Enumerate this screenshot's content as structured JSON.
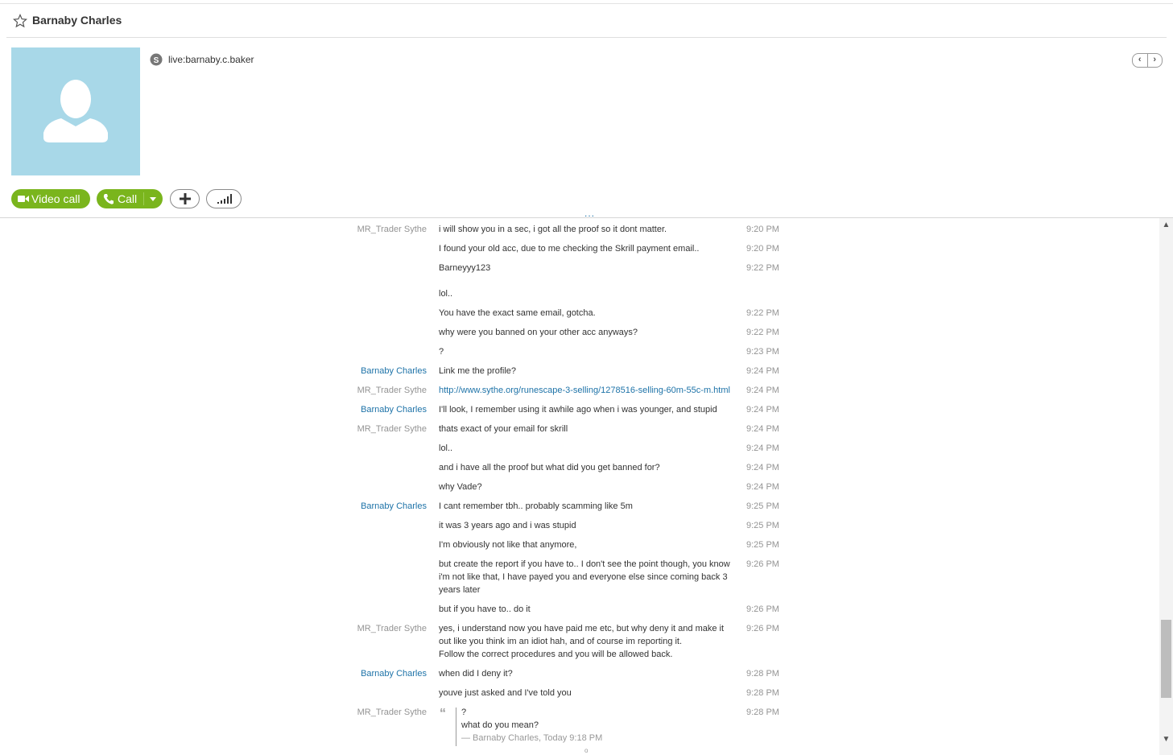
{
  "header": {
    "title": "Barnaby Charles"
  },
  "profile": {
    "account": "live:barnaby.c.baker"
  },
  "nav": {
    "prev": "‹",
    "next": "›"
  },
  "actions": {
    "video_call": "Video call",
    "call": "Call"
  },
  "ellipsis": "...",
  "messages": [
    {
      "sender": "MR_Trader Sythe",
      "who": "them",
      "text": "i will show you in a sec, i got all the proof so it dont matter.",
      "time": "9:20 PM"
    },
    {
      "sender": "",
      "who": "them",
      "text": "I found your old acc, due to me checking the Skrill payment email..",
      "time": "9:20 PM"
    },
    {
      "sender": "",
      "who": "them",
      "text": "Barneyyy123",
      "time": "9:22 PM"
    },
    {
      "sender": "",
      "who": "them",
      "text": "lol..",
      "time": ""
    },
    {
      "sender": "",
      "who": "them",
      "text": "You have the exact same email, gotcha.",
      "time": "9:22 PM"
    },
    {
      "sender": "",
      "who": "them",
      "text": "why were you banned on your other acc anyways?",
      "time": "9:22 PM"
    },
    {
      "sender": "",
      "who": "them",
      "text": "?",
      "time": "9:23 PM"
    },
    {
      "sender": "Barnaby Charles",
      "who": "me",
      "text": "Link me the profile?",
      "time": "9:24 PM"
    },
    {
      "sender": "MR_Trader Sythe",
      "who": "them",
      "text": "http://www.sythe.org/runescape-3-selling/1278516-selling-60m-55c-m.html",
      "time": "9:24 PM",
      "link": true
    },
    {
      "sender": "Barnaby Charles",
      "who": "me",
      "text": "I'll look, I remember using it awhile ago when i was younger, and stupid",
      "time": "9:24 PM"
    },
    {
      "sender": "MR_Trader Sythe",
      "who": "them",
      "text": "thats exact of your email for skrill",
      "time": "9:24 PM"
    },
    {
      "sender": "",
      "who": "them",
      "text": "lol..",
      "time": "9:24 PM"
    },
    {
      "sender": "",
      "who": "them",
      "text": "and i have all the proof but what did you get banned for?",
      "time": "9:24 PM"
    },
    {
      "sender": "",
      "who": "them",
      "text": "why Vade?",
      "time": "9:24 PM"
    },
    {
      "sender": "Barnaby Charles",
      "who": "me",
      "text": "I cant remember tbh.. probably scamming like 5m",
      "time": "9:25 PM"
    },
    {
      "sender": "",
      "who": "me",
      "text": "it was 3 years ago and i was stupid",
      "time": "9:25 PM"
    },
    {
      "sender": "",
      "who": "me",
      "text": "I'm obviously not like that anymore,",
      "time": "9:25 PM"
    },
    {
      "sender": "",
      "who": "me",
      "text": "but create the report if you have to.. I don't see the point though, you know i'm not like that, I have payed you and everyone else since coming back 3 years later",
      "time": "9:26 PM"
    },
    {
      "sender": "",
      "who": "me",
      "text": "but if you have to.. do it",
      "time": "9:26 PM"
    },
    {
      "sender": "MR_Trader Sythe",
      "who": "them",
      "text": "yes, i understand now you have paid me etc, but why deny it and make it out like you think im an idiot hah, and of course im reporting it.\nFollow the correct procedures and you will be allowed back.",
      "time": "9:26 PM"
    },
    {
      "sender": "Barnaby Charles",
      "who": "me",
      "text": "when did I deny it?",
      "time": "9:28 PM"
    },
    {
      "sender": "",
      "who": "me",
      "text": "youve just asked and I've told you",
      "time": "9:28 PM"
    },
    {
      "sender": "MR_Trader Sythe",
      "who": "them",
      "text": "",
      "time": "9:28 PM",
      "quote": {
        "lines": [
          "?",
          "what do you mean?"
        ],
        "attribution": "— Barnaby Charles, Today 9:18 PM"
      }
    }
  ],
  "colors": {
    "accent_green": "#7ab51d",
    "link_blue": "#1e73a8",
    "avatar_bg": "#a8d8e8"
  }
}
